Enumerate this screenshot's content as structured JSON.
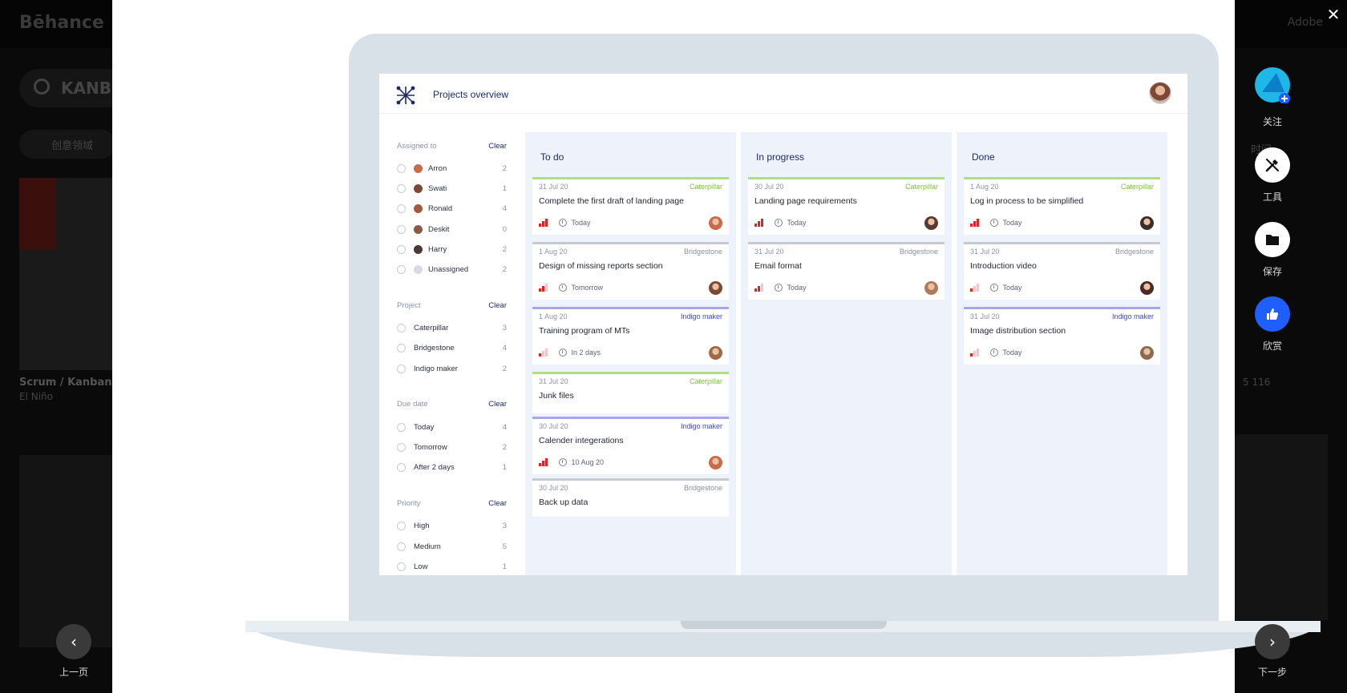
{
  "background": {
    "logo": "Bēhance",
    "adobe_label": "Adobe",
    "search_text": "KANB",
    "filter_label": "创意领域",
    "card_title": "Scrum / Kanban",
    "card_author": "El Niño",
    "right_meta": "5   116",
    "right_filter": "时间"
  },
  "app": {
    "title": "Projects overview",
    "filters": [
      {
        "label": "Assigned to",
        "clear": "Clear",
        "options": [
          {
            "name": "Arron",
            "count": "2",
            "avatar": "#c96a4a"
          },
          {
            "name": "Swati",
            "count": "1",
            "avatar": "#7a4a36"
          },
          {
            "name": "Ronald",
            "count": "4",
            "avatar": "#a05a3e"
          },
          {
            "name": "Deskit",
            "count": "0",
            "avatar": "#8a5a44"
          },
          {
            "name": "Harry",
            "count": "2",
            "avatar": "#4a3a34"
          },
          {
            "name": "Unassigned",
            "count": "2",
            "avatar": "#d6dae2"
          }
        ]
      },
      {
        "label": "Project",
        "clear": "Clear",
        "options": [
          {
            "name": "Caterpillar",
            "count": "3"
          },
          {
            "name": "Bridgestone",
            "count": "4"
          },
          {
            "name": "Indigo maker",
            "count": "2"
          }
        ]
      },
      {
        "label": "Due date",
        "clear": "Clear",
        "options": [
          {
            "name": "Today",
            "count": "4"
          },
          {
            "name": "Tomorrow",
            "count": "2"
          },
          {
            "name": "After 2 days",
            "count": "1"
          }
        ]
      },
      {
        "label": "Priority",
        "clear": "Clear",
        "options": [
          {
            "name": "High",
            "count": "3"
          },
          {
            "name": "Medium",
            "count": "5"
          },
          {
            "name": "Low",
            "count": "1"
          }
        ]
      }
    ],
    "project_colors": {
      "Caterpillar": "#7cc23a",
      "Bridgestone": "#8a8f99",
      "Indigo maker": "#3f48c8"
    },
    "project_borders": {
      "Caterpillar": "#b3de7d",
      "Bridgestone": "#c6c9cf",
      "Indigo maker": "#a9a6e8"
    },
    "columns": [
      {
        "title": "To do",
        "cards": [
          {
            "date": "31 Jul 20",
            "project": "Caterpillar",
            "title": "Complete the first draft of landing page",
            "priority": 3,
            "when": "Today",
            "avatar": "#c96a4a"
          },
          {
            "date": "1 Aug 20",
            "project": "Bridgestone",
            "title": "Design of missing reports section",
            "priority": 2,
            "when": "Tomorrow",
            "avatar": "#7a4a36"
          },
          {
            "date": "1 Aug 20",
            "project": "Indigo maker",
            "title": "Training program of MTs",
            "priority": 1,
            "when": "In 2 days",
            "avatar": "#a06a48"
          },
          {
            "date": "31 Jul 20",
            "project": "Caterpillar",
            "title": "Junk files",
            "priority": 0,
            "when": "",
            "avatar": ""
          },
          {
            "date": "30 Jul 20",
            "project": "Indigo maker",
            "title": "Calender integerations",
            "priority": 3,
            "when": "10 Aug 20",
            "avatar": "#c96a4a"
          },
          {
            "date": "30 Jul 20",
            "project": "Bridgestone",
            "title": "Back up data",
            "priority": 0,
            "when": "",
            "avatar": ""
          }
        ]
      },
      {
        "title": "In progress",
        "cards": [
          {
            "date": "30 Jul 20",
            "project": "Caterpillar",
            "title": "Landing page requirements",
            "priority": 3,
            "when": "Today",
            "avatar": "#5a3a2e"
          },
          {
            "date": "31 Jul 20",
            "project": "Bridgestone",
            "title": "Email format",
            "priority": 2,
            "when": "Today",
            "avatar": "#b07a5a"
          }
        ]
      },
      {
        "title": "Done",
        "cards": [
          {
            "date": "1 Aug 20",
            "project": "Caterpillar",
            "title": "Log in process to be simplified",
            "priority": 3,
            "when": "Today",
            "avatar": "#3a2e2a"
          },
          {
            "date": "31 Jul 20",
            "project": "Bridgestone",
            "title": "Introduction video",
            "priority": 1,
            "when": "Today",
            "avatar": "#4a2a22"
          },
          {
            "date": "31 Jul 20",
            "project": "Indigo maker",
            "title": "Image distribution section",
            "priority": 1,
            "when": "Today",
            "avatar": "#8a6a50"
          }
        ]
      }
    ]
  },
  "rail": {
    "follow": "关注",
    "tools": "工具",
    "save": "保存",
    "appreciate": "欣赏"
  },
  "nav": {
    "prev": "上一页",
    "next": "下一步"
  }
}
